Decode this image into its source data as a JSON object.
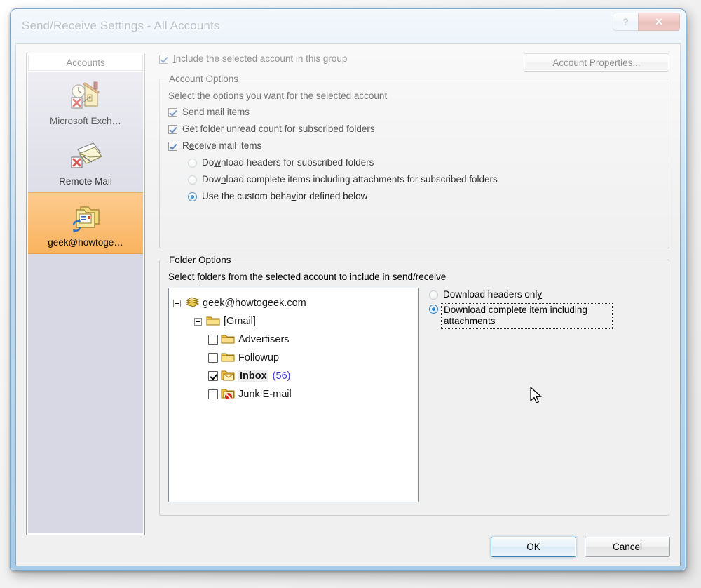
{
  "window": {
    "title": "Send/Receive Settings - All Accounts",
    "caption_buttons": [
      {
        "name": "help",
        "glyph": "?"
      },
      {
        "name": "close",
        "glyph": "✕"
      }
    ]
  },
  "sidebar": {
    "header": "Accounts",
    "header_accel": "o",
    "items": [
      {
        "label": "Microsoft Exch…",
        "icon": "exchange-account-icon",
        "selected": false
      },
      {
        "label": "Remote Mail",
        "icon": "remote-mail-icon",
        "selected": false
      },
      {
        "label": "geek@howtoge…",
        "icon": "send-receive-folder-icon",
        "selected": true
      }
    ],
    "selected_color": "#f9b35c",
    "list_background": "#d8d8e4"
  },
  "top_row": {
    "include_checkbox": {
      "label_pre": "",
      "accel": "I",
      "label_post": "nclude the selected account in this group",
      "full_label": "Include the selected account in this group",
      "checked": true
    },
    "account_properties_button": "Account Properties..."
  },
  "account_options": {
    "title": "Account Options",
    "description": "Select the options you want for the selected account",
    "checkboxes": [
      {
        "accel": "S",
        "pre": "",
        "post": "end mail items",
        "full": "Send mail items",
        "checked": true
      },
      {
        "accel": "u",
        "pre": "Get folder ",
        "post": "nread count for subscribed folders",
        "full": "Get folder unread count for subscribed folders",
        "checked": true
      },
      {
        "accel": "e",
        "pre": "R",
        "post": "ceive mail items",
        "full": "Receive mail items",
        "checked": true
      }
    ],
    "radios": [
      {
        "accel": "w",
        "pre": "Do",
        "post": "nload headers for subscribed folders",
        "full": "Download headers for subscribed folders",
        "checked": false
      },
      {
        "accel": "n",
        "pre": "Dow",
        "post": "load complete items including attachments for subscribed folders",
        "full": "Download complete items including attachments for subscribed folders",
        "checked": false
      },
      {
        "accel": "v",
        "pre": "Use the custom beha",
        "post": "ior defined below",
        "full": "Use the custom behavior defined below",
        "checked": true
      }
    ]
  },
  "folder_options": {
    "title": "Folder Options",
    "description_pre": "Select ",
    "description_accel": "f",
    "description_post": "olders from the selected account to include in send/receive",
    "description_full": "Select folders from the selected account to include in send/receive",
    "tree": [
      {
        "level": 0,
        "type": "root",
        "expander": "minus",
        "icon": "mailbox-stack-icon",
        "label": "geek@howtogeek.com",
        "checkbox": null,
        "count": null,
        "bold": false
      },
      {
        "level": 1,
        "type": "folder",
        "expander": "plus",
        "icon": "folder-icon",
        "label": "[Gmail]",
        "checkbox": null,
        "count": null,
        "bold": false
      },
      {
        "level": 2,
        "type": "folder",
        "expander": null,
        "icon": "folder-icon",
        "label": "Advertisers",
        "checkbox": false,
        "count": null,
        "bold": false
      },
      {
        "level": 2,
        "type": "folder",
        "expander": null,
        "icon": "folder-icon",
        "label": "Followup",
        "checkbox": false,
        "count": null,
        "bold": false
      },
      {
        "level": 2,
        "type": "folder",
        "expander": null,
        "icon": "inbox-folder-icon",
        "label": "Inbox",
        "checkbox": true,
        "count": "(56)",
        "bold": true
      },
      {
        "level": 2,
        "type": "folder",
        "expander": null,
        "icon": "junk-folder-icon",
        "label": "Junk E-mail",
        "checkbox": false,
        "count": null,
        "bold": false
      }
    ],
    "count_color": "#3b3bc4",
    "radios": [
      {
        "accel": "y",
        "pre": "Download headers onl",
        "post": "",
        "full": "Download headers only",
        "checked": false,
        "focused": false
      },
      {
        "accel": "c",
        "pre": "Download ",
        "post": "omplete item including attachments",
        "full": "Download complete item including attachments",
        "checked": true,
        "focused": true
      }
    ]
  },
  "footer": {
    "ok_label": "OK",
    "cancel_label": "Cancel"
  }
}
